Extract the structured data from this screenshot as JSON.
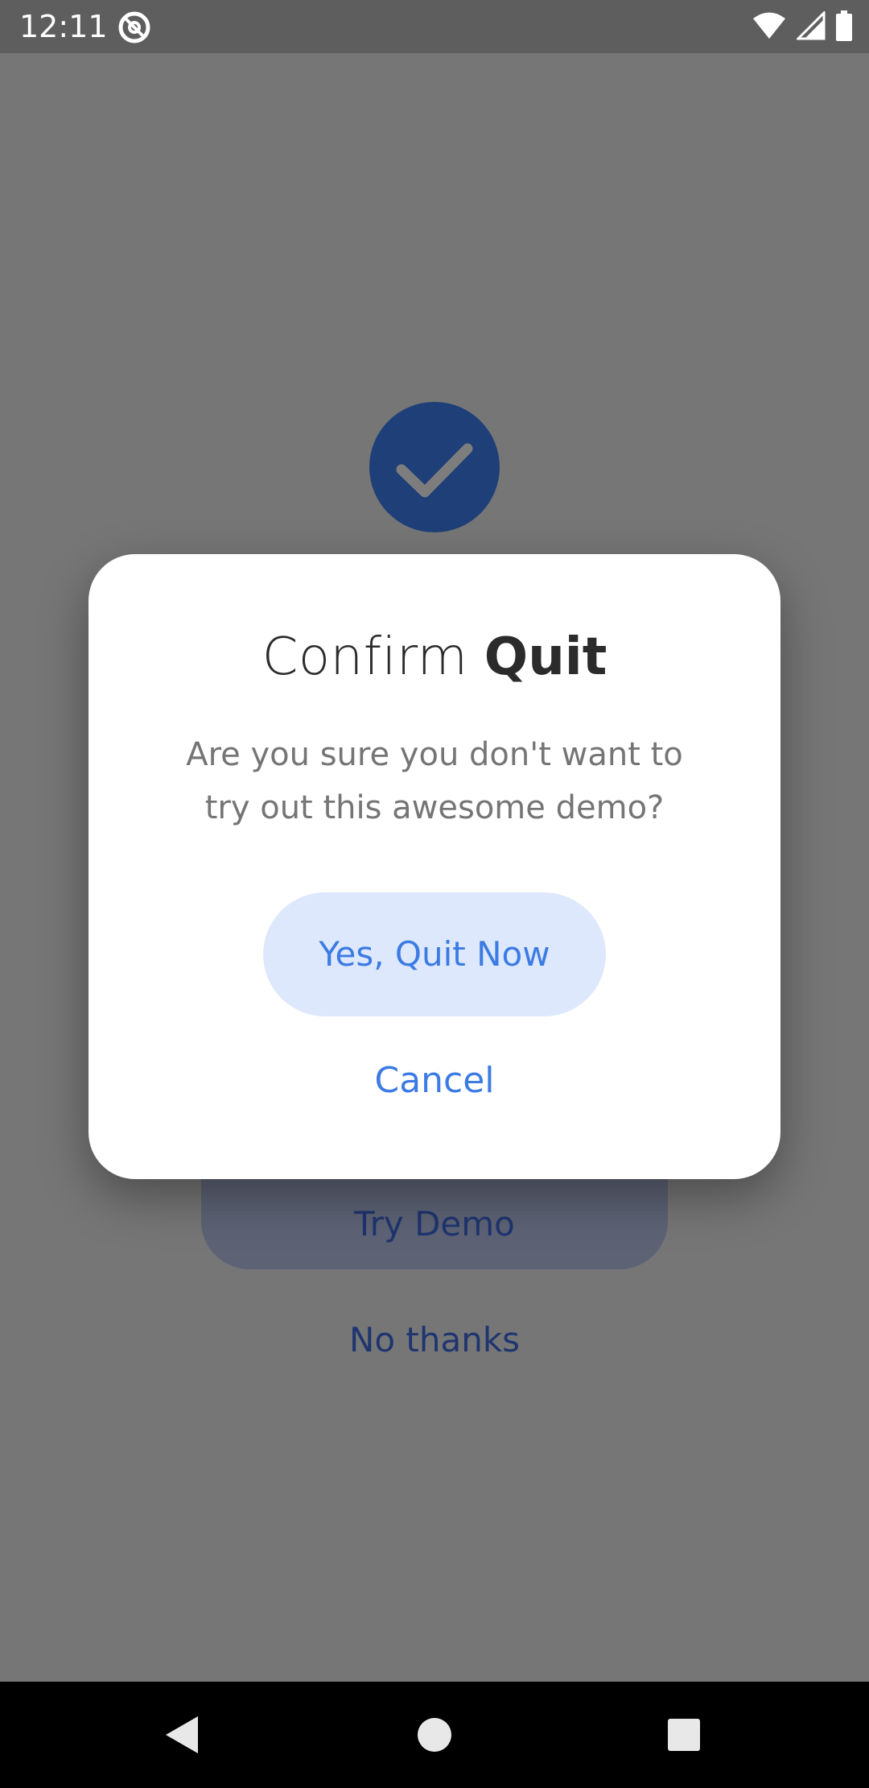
{
  "status_bar": {
    "time": "12:11",
    "app_icon": "at-sign-icon",
    "icons": [
      "wifi-icon",
      "cellular-signal-icon",
      "battery-icon"
    ]
  },
  "background": {
    "success_icon": "checkmark-icon",
    "primary_button_label": "Try Demo",
    "secondary_link_label": "No thanks"
  },
  "dialog": {
    "title_normal": "Confirm",
    "title_strong": "Quit",
    "message": "Are you sure you don't want to try out this awesome demo?",
    "confirm_label": "Yes, Quit Now",
    "cancel_label": "Cancel"
  },
  "nav_bar": {
    "buttons": [
      "back-icon",
      "home-icon",
      "recents-icon"
    ]
  },
  "colors": {
    "scrim": "#767676",
    "accent": "#3c7be3",
    "accent_soft": "#dde8fc",
    "brand_dark": "#1f3f78",
    "dialog_bg": "#ffffff"
  }
}
